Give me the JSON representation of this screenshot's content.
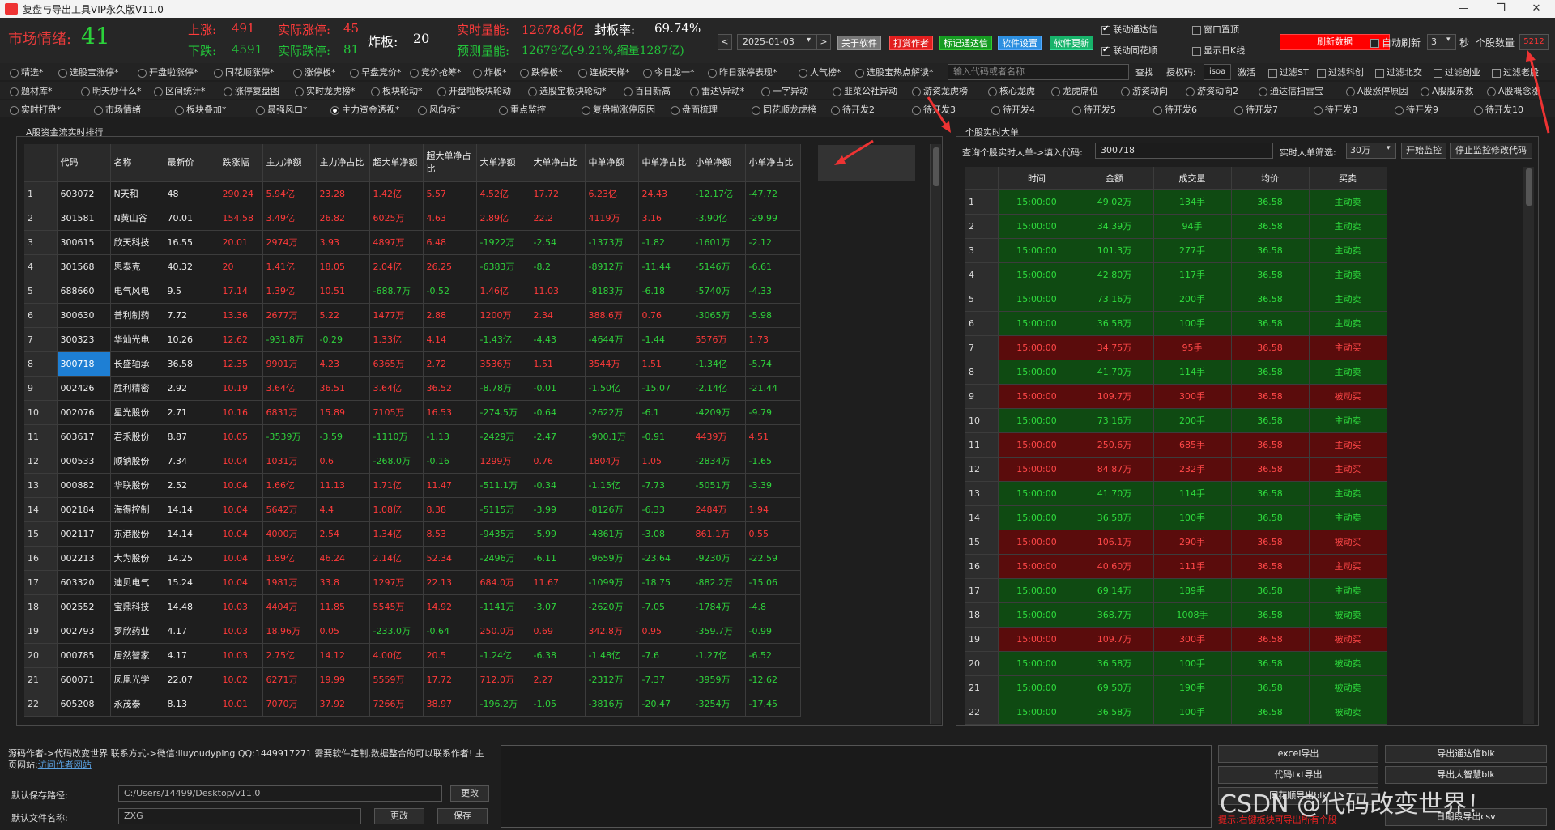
{
  "window": {
    "title": "复盘与导出工具VIP永久版V11.0",
    "min": "—",
    "max": "❐",
    "close": "✕"
  },
  "market": {
    "mood_label": "市场情绪:",
    "mood_value": "41",
    "up_label": "上涨:",
    "up_value": "491",
    "limit_up_label": "实际涨停:",
    "limit_up_value": "45",
    "down_label": "下跌:",
    "down_value": "4591",
    "limit_down_label": "实际跌停:",
    "limit_down_value": "81",
    "broken_label": "炸板:",
    "broken_value": "20",
    "volume_label": "实时量能:",
    "volume_value": "12678.6亿",
    "seal_label": "封板率:",
    "seal_value": "69.74%",
    "forecast_label": "预测量能:",
    "forecast_value": "12679亿(-9.21%,缩量1287亿)"
  },
  "nav": {
    "prev": "<",
    "date": "2025-01-03",
    "next": ">",
    "about": "关于软件",
    "reward": "打赏作者",
    "mark_tdx": "标记通达信",
    "settings": "软件设置",
    "update": "软件更新"
  },
  "toggles": {
    "link_tdx": "联动通达信",
    "link_ths": "联动同花顺",
    "pin": "窗口置顶",
    "show_daily": "显示日K线",
    "refresh": "刷新数据",
    "auto_refresh": "自动刷新",
    "interval": "3",
    "sec": "秒",
    "count_label": "个股数量",
    "count_value": "5212"
  },
  "row1": [
    "精选*",
    "选股宝涨停*",
    "开盘啦涨停*",
    "同花顺涨停*",
    "涨停板*",
    "早盘竞价*",
    "竞价抢筹*",
    "炸板*",
    "跌停板*",
    "连板天梯*",
    "今日龙一*",
    "昨日涨停表现*",
    "人气榜*",
    "选股宝热点解读*"
  ],
  "search": {
    "placeholder": "输入代码或者名称",
    "btn": "查找",
    "auth_label": "授权码:",
    "auth_value": "isoa",
    "activate": "激活"
  },
  "filters": [
    "过滤ST",
    "过滤科创",
    "过滤北交",
    "过滤创业",
    "过滤老股"
  ],
  "row2": [
    "题材库*",
    "明天炒什么*",
    "区间统计*",
    "涨停复盘图",
    "实时龙虎榜*",
    "板块轮动*",
    "开盘啦板块轮动",
    "选股宝板块轮动*",
    "百日新高",
    "雷达\\异动*",
    "一字异动",
    "韭菜公社异动",
    "游资龙虎榜",
    "核心龙虎",
    "龙虎席位",
    "游资动向",
    "游资动向2",
    "通达信扫雷宝",
    "A股涨停原因",
    "A股股东数",
    "A股概念涨"
  ],
  "row3": [
    "实时打盘*",
    "市场情绪",
    "板块叠加*",
    "最强风口*",
    "主力资金透视*",
    "风向标*",
    "重点监控",
    "复盘啦涨停原因",
    "盘面梳理",
    "同花顺龙虎榜",
    "待开发2",
    "待开发3",
    "待开发4",
    "待开发5",
    "待开发6",
    "待开发7",
    "待开发8",
    "待开发9",
    "待开发10"
  ],
  "left": {
    "title": "A股资金流实时排行",
    "headers": [
      "代码",
      "名称",
      "最新价",
      "跌涨幅",
      "主力净额",
      "主力净占比",
      "超大单净额",
      "超大单净占比",
      "大单净额",
      "大单净占比",
      "中单净额",
      "中单净占比",
      "小单净额",
      "小单净占比"
    ],
    "rows": [
      [
        "1",
        "603072",
        "N天和",
        "48",
        "290.24",
        "5.94亿",
        "23.28",
        "1.42亿",
        "5.57",
        "4.52亿",
        "17.72",
        "6.23亿",
        "24.43",
        "-12.17亿",
        "-47.72"
      ],
      [
        "2",
        "301581",
        "N黄山谷",
        "70.01",
        "154.58",
        "3.49亿",
        "26.82",
        "6025万",
        "4.63",
        "2.89亿",
        "22.2",
        "4119万",
        "3.16",
        "-3.90亿",
        "-29.99"
      ],
      [
        "3",
        "300615",
        "欣天科技",
        "16.55",
        "20.01",
        "2974万",
        "3.93",
        "4897万",
        "6.48",
        "-1922万",
        "-2.54",
        "-1373万",
        "-1.82",
        "-1601万",
        "-2.12"
      ],
      [
        "4",
        "301568",
        "思泰克",
        "40.32",
        "20",
        "1.41亿",
        "18.05",
        "2.04亿",
        "26.25",
        "-6383万",
        "-8.2",
        "-8912万",
        "-11.44",
        "-5146万",
        "-6.61"
      ],
      [
        "5",
        "688660",
        "电气风电",
        "9.5",
        "17.14",
        "1.39亿",
        "10.51",
        "-688.7万",
        "-0.52",
        "1.46亿",
        "11.03",
        "-8183万",
        "-6.18",
        "-5740万",
        "-4.33"
      ],
      [
        "6",
        "300630",
        "普利制药",
        "7.72",
        "13.36",
        "2677万",
        "5.22",
        "1477万",
        "2.88",
        "1200万",
        "2.34",
        "388.6万",
        "0.76",
        "-3065万",
        "-5.98"
      ],
      [
        "7",
        "300323",
        "华灿光电",
        "10.26",
        "12.62",
        "-931.8万",
        "-0.29",
        "1.33亿",
        "4.14",
        "-1.43亿",
        "-4.43",
        "-4644万",
        "-1.44",
        "5576万",
        "1.73"
      ],
      [
        "8",
        "300718",
        "长盛轴承",
        "36.58",
        "12.35",
        "9901万",
        "4.23",
        "6365万",
        "2.72",
        "3536万",
        "1.51",
        "3544万",
        "1.51",
        "-1.34亿",
        "-5.74"
      ],
      [
        "9",
        "002426",
        "胜利精密",
        "2.92",
        "10.19",
        "3.64亿",
        "36.51",
        "3.64亿",
        "36.52",
        "-8.78万",
        "-0.01",
        "-1.50亿",
        "-15.07",
        "-2.14亿",
        "-21.44"
      ],
      [
        "10",
        "002076",
        "星光股份",
        "2.71",
        "10.16",
        "6831万",
        "15.89",
        "7105万",
        "16.53",
        "-274.5万",
        "-0.64",
        "-2622万",
        "-6.1",
        "-4209万",
        "-9.79"
      ],
      [
        "11",
        "603617",
        "君禾股份",
        "8.87",
        "10.05",
        "-3539万",
        "-3.59",
        "-1110万",
        "-1.13",
        "-2429万",
        "-2.47",
        "-900.1万",
        "-0.91",
        "4439万",
        "4.51"
      ],
      [
        "12",
        "000533",
        "顺钠股份",
        "7.34",
        "10.04",
        "1031万",
        "0.6",
        "-268.0万",
        "-0.16",
        "1299万",
        "0.76",
        "1804万",
        "1.05",
        "-2834万",
        "-1.65"
      ],
      [
        "13",
        "000882",
        "华联股份",
        "2.52",
        "10.04",
        "1.66亿",
        "11.13",
        "1.71亿",
        "11.47",
        "-511.1万",
        "-0.34",
        "-1.15亿",
        "-7.73",
        "-5051万",
        "-3.39"
      ],
      [
        "14",
        "002184",
        "海得控制",
        "14.14",
        "10.04",
        "5642万",
        "4.4",
        "1.08亿",
        "8.38",
        "-5115万",
        "-3.99",
        "-8126万",
        "-6.33",
        "2484万",
        "1.94"
      ],
      [
        "15",
        "002117",
        "东港股份",
        "14.14",
        "10.04",
        "4000万",
        "2.54",
        "1.34亿",
        "8.53",
        "-9435万",
        "-5.99",
        "-4861万",
        "-3.08",
        "861.1万",
        "0.55"
      ],
      [
        "16",
        "002213",
        "大为股份",
        "14.25",
        "10.04",
        "1.89亿",
        "46.24",
        "2.14亿",
        "52.34",
        "-2496万",
        "-6.11",
        "-9659万",
        "-23.64",
        "-9230万",
        "-22.59"
      ],
      [
        "17",
        "603320",
        "迪贝电气",
        "15.24",
        "10.04",
        "1981万",
        "33.8",
        "1297万",
        "22.13",
        "684.0万",
        "11.67",
        "-1099万",
        "-18.75",
        "-882.2万",
        "-15.06"
      ],
      [
        "18",
        "002552",
        "宝鼎科技",
        "14.48",
        "10.03",
        "4404万",
        "11.85",
        "5545万",
        "14.92",
        "-1141万",
        "-3.07",
        "-2620万",
        "-7.05",
        "-1784万",
        "-4.8"
      ],
      [
        "19",
        "002793",
        "罗欣药业",
        "4.17",
        "10.03",
        "18.96万",
        "0.05",
        "-233.0万",
        "-0.64",
        "250.0万",
        "0.69",
        "342.8万",
        "0.95",
        "-359.7万",
        "-0.99"
      ],
      [
        "20",
        "000785",
        "居然智家",
        "4.17",
        "10.03",
        "2.75亿",
        "14.12",
        "4.00亿",
        "20.5",
        "-1.24亿",
        "-6.38",
        "-1.48亿",
        "-7.6",
        "-1.27亿",
        "-6.52"
      ],
      [
        "21",
        "600071",
        "凤凰光学",
        "22.07",
        "10.02",
        "6271万",
        "19.99",
        "5559万",
        "17.72",
        "712.0万",
        "2.27",
        "-2312万",
        "-7.37",
        "-3959万",
        "-12.62"
      ],
      [
        "22",
        "605208",
        "永茂泰",
        "8.13",
        "10.01",
        "7070万",
        "37.92",
        "7266万",
        "38.97",
        "-196.2万",
        "-1.05",
        "-3816万",
        "-20.47",
        "-3254万",
        "-17.45"
      ]
    ]
  },
  "right": {
    "title": "个股实时大单",
    "query_label": "查询个股实时大单->填入代码:",
    "query_value": "300718",
    "filter_label": "实时大单筛选:",
    "filter_value": "30万",
    "start": "开始监控",
    "stop": "停止监控修改代码",
    "headers": [
      "时间",
      "金额",
      "成交量",
      "均价",
      "买卖"
    ],
    "rows": [
      [
        "1",
        "15:00:00",
        "49.02万",
        "134手",
        "36.58",
        "主动卖",
        "g"
      ],
      [
        "2",
        "15:00:00",
        "34.39万",
        "94手",
        "36.58",
        "主动卖",
        "g"
      ],
      [
        "3",
        "15:00:00",
        "101.3万",
        "277手",
        "36.58",
        "主动卖",
        "g"
      ],
      [
        "4",
        "15:00:00",
        "42.80万",
        "117手",
        "36.58",
        "主动卖",
        "g"
      ],
      [
        "5",
        "15:00:00",
        "73.16万",
        "200手",
        "36.58",
        "主动卖",
        "g"
      ],
      [
        "6",
        "15:00:00",
        "36.58万",
        "100手",
        "36.58",
        "主动卖",
        "g"
      ],
      [
        "7",
        "15:00:00",
        "34.75万",
        "95手",
        "36.58",
        "主动买",
        "r"
      ],
      [
        "8",
        "15:00:00",
        "41.70万",
        "114手",
        "36.58",
        "主动卖",
        "g"
      ],
      [
        "9",
        "15:00:00",
        "109.7万",
        "300手",
        "36.58",
        "被动买",
        "r"
      ],
      [
        "10",
        "15:00:00",
        "73.16万",
        "200手",
        "36.58",
        "主动卖",
        "g"
      ],
      [
        "11",
        "15:00:00",
        "250.6万",
        "685手",
        "36.58",
        "主动买",
        "r"
      ],
      [
        "12",
        "15:00:00",
        "84.87万",
        "232手",
        "36.58",
        "主动买",
        "r"
      ],
      [
        "13",
        "15:00:00",
        "41.70万",
        "114手",
        "36.58",
        "主动卖",
        "g"
      ],
      [
        "14",
        "15:00:00",
        "36.58万",
        "100手",
        "36.58",
        "主动卖",
        "g"
      ],
      [
        "15",
        "15:00:00",
        "106.1万",
        "290手",
        "36.58",
        "被动买",
        "r"
      ],
      [
        "16",
        "15:00:00",
        "40.60万",
        "111手",
        "36.58",
        "主动买",
        "r"
      ],
      [
        "17",
        "15:00:00",
        "69.14万",
        "189手",
        "36.58",
        "主动卖",
        "g"
      ],
      [
        "18",
        "15:00:00",
        "368.7万",
        "1008手",
        "36.58",
        "被动卖",
        "g"
      ],
      [
        "19",
        "15:00:00",
        "109.7万",
        "300手",
        "36.58",
        "被动买",
        "r"
      ],
      [
        "20",
        "15:00:00",
        "36.58万",
        "100手",
        "36.58",
        "被动卖",
        "g"
      ],
      [
        "21",
        "15:00:00",
        "69.50万",
        "190手",
        "36.58",
        "被动卖",
        "g"
      ],
      [
        "22",
        "15:00:00",
        "36.58万",
        "100手",
        "36.58",
        "被动卖",
        "g"
      ]
    ]
  },
  "bottom": {
    "info": "源码作者->代码改变世界 联系方式->微信:liuyoudyping QQ:1449917271 需要软件定制,数据整合的可以联系作者! 主页网站:",
    "link": "访问作者网站",
    "save_path_label": "默认保存路径:",
    "save_path": "C:/Users/14499/Desktop/v11.0",
    "change": "更改",
    "file_label": "默认文件名称:",
    "file_name": "ZXG",
    "save": "保存",
    "excel": "excel导出",
    "txt": "代码txt导出",
    "ths": "同花顺导出blk",
    "tdx": "导出通达信blk",
    "dzh": "导出大智慧blk",
    "csv": "日期段导出csv",
    "hint": "提示:右键板块可导出所有个股"
  },
  "watermark": "CSDN @代码改变世界！"
}
